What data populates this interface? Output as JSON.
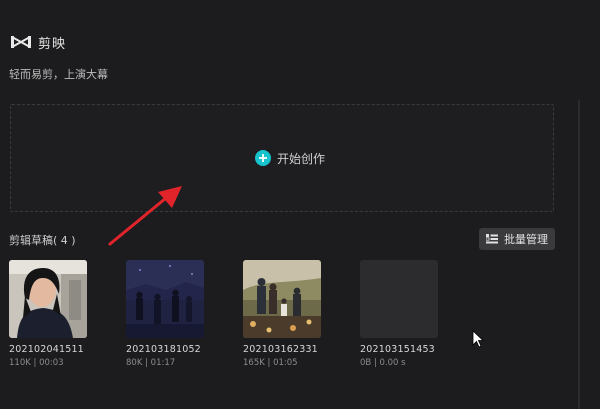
{
  "header": {
    "app_name": "剪映",
    "logo_icon": "capcut-logo-icon"
  },
  "slogan": "轻而易剪，上演大幕",
  "create": {
    "label": "开始创作",
    "icon": "plus-icon",
    "accent": "#17c3cc"
  },
  "drafts": {
    "title": "剪辑草稿( 4 )",
    "batch_button": "批量管理",
    "batch_icon": "list-icon",
    "items": [
      {
        "name": "202102041511",
        "meta": "110K | 00:03"
      },
      {
        "name": "202103181052",
        "meta": "80K | 01:17"
      },
      {
        "name": "202103162331",
        "meta": "165K | 01:05"
      },
      {
        "name": "202103151453",
        "meta": "0B | 0.00 s"
      }
    ]
  },
  "annotation": {
    "arrow_color": "#e0242a"
  }
}
